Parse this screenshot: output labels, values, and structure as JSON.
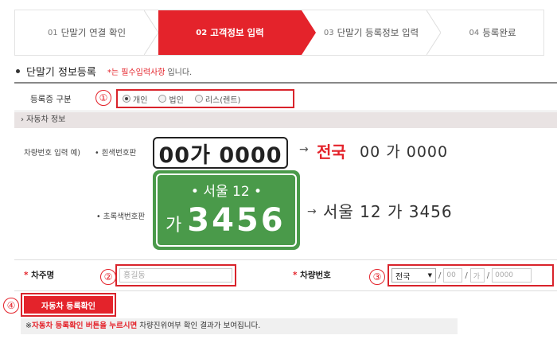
{
  "steps": [
    {
      "num": "01",
      "label": "단말기 연결 확인"
    },
    {
      "num": "02",
      "label": "고객정보 입력"
    },
    {
      "num": "03",
      "label": "단말기 등록정보 입력"
    },
    {
      "num": "04",
      "label": "등록완료"
    }
  ],
  "section": {
    "title": "단말기 정보등록",
    "required_note": "*는 필수입력사항",
    "required_suffix": "입니다."
  },
  "registration": {
    "label": "등록증 구분",
    "badge": "①",
    "options": [
      "개인",
      "법인",
      "리스(렌트)"
    ],
    "selected": "개인"
  },
  "vehicle_band": "› 자동차 정보",
  "examples": {
    "intro": "차량번호 입력 예)",
    "white_label": "• 흰색번호판",
    "white_plate": "00가 0000",
    "white_result_prefix": "전국",
    "white_result_rest": "00 가 0000",
    "green_label": "• 초록색번호판",
    "green_plate_top": "•  서울 12  •",
    "green_plate_ga": "가",
    "green_plate_num": "3456",
    "green_result": "서울 12 가 3456",
    "arrow": "→"
  },
  "form": {
    "owner_label": "차주명",
    "owner_badge": "②",
    "owner_placeholder": "홍길동",
    "car_label": "차량번호",
    "car_badge": "③",
    "region_value": "전국",
    "region_arrow": "▼",
    "slash": "/",
    "num1_placeholder": "00",
    "ga_placeholder": "가",
    "num2_placeholder": "0000",
    "star": "*"
  },
  "confirm": {
    "badge": "④",
    "button_label": "자동차 등록확인",
    "notice_prefix": "※",
    "notice_red": "자동차 등록확인 버튼을 누르시면",
    "notice_rest": "차량진위여부 확인 결과가 보여집니다."
  },
  "colors": {
    "accent": "#e4232b",
    "plate_green": "#4a9a4a"
  }
}
